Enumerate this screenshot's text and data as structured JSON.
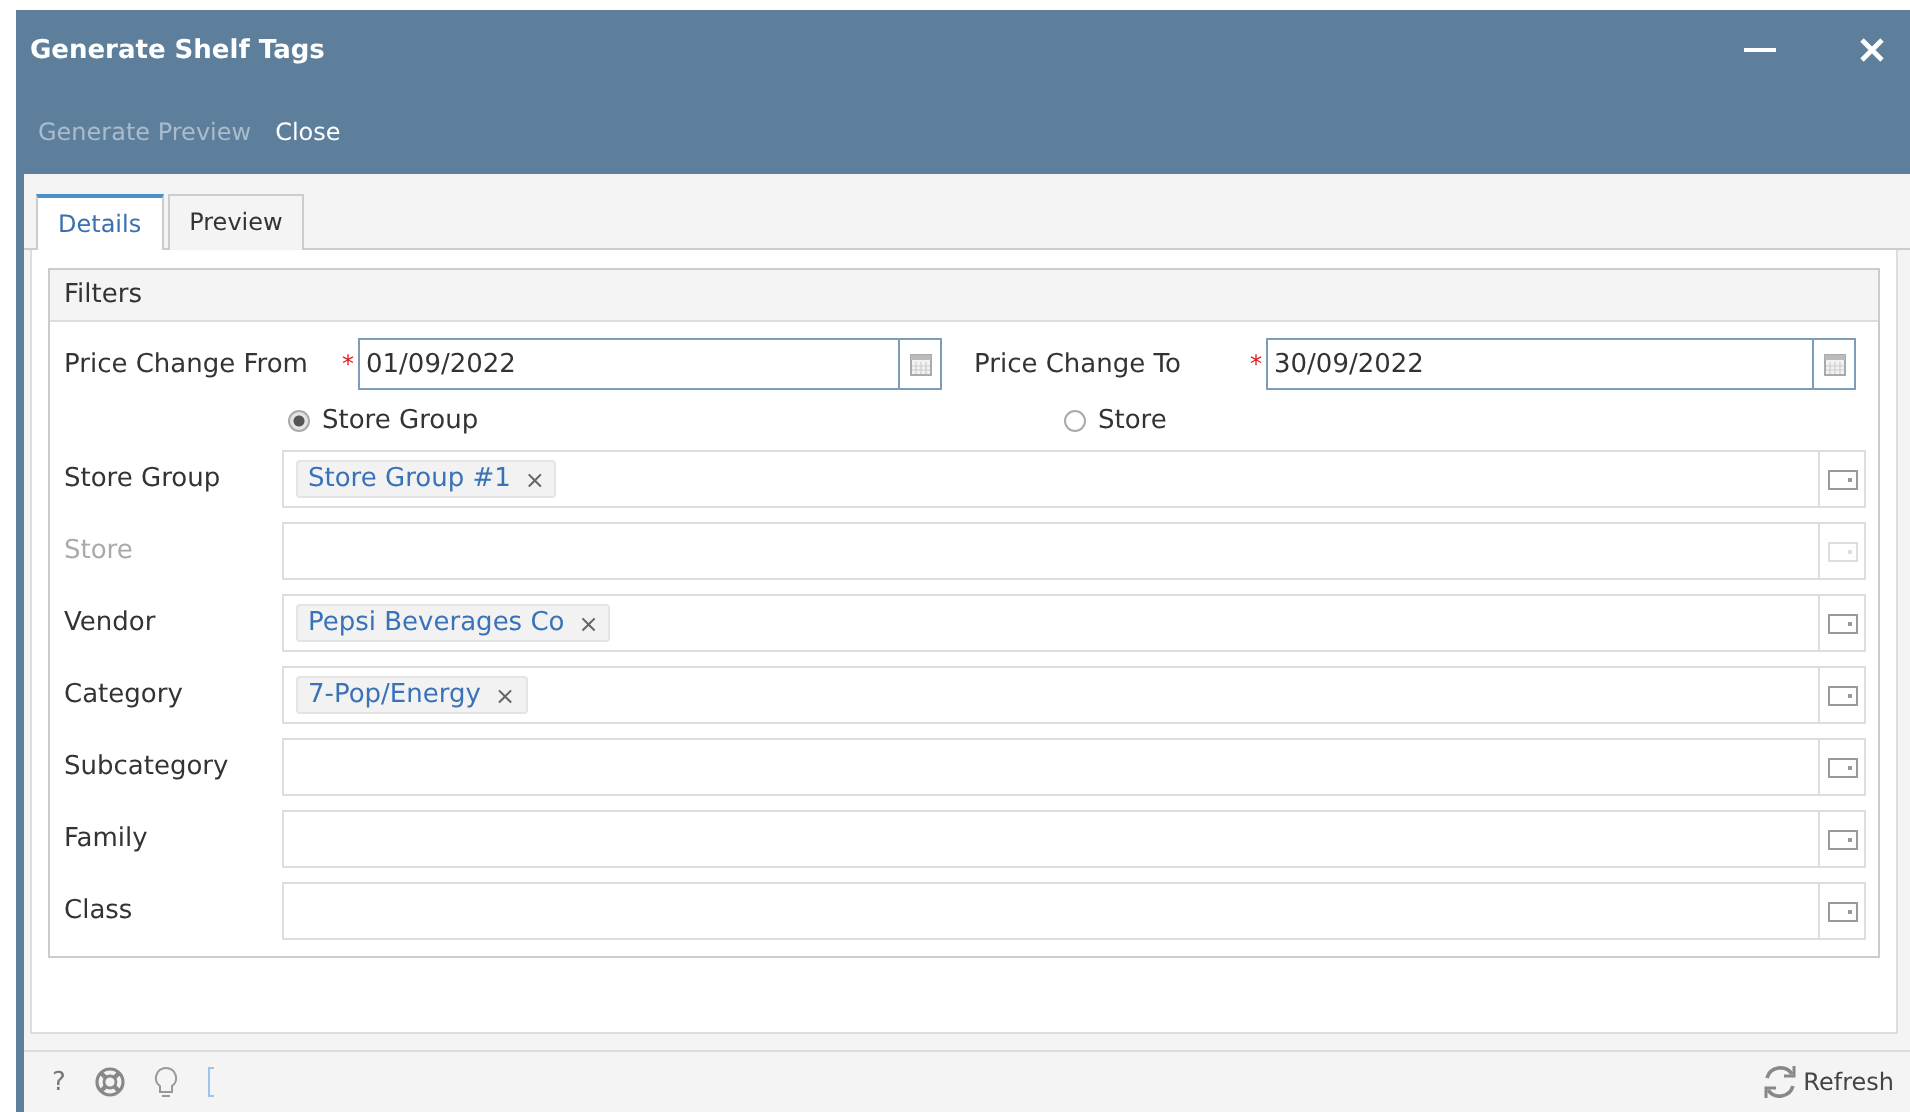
{
  "window": {
    "title": "Generate Shelf Tags"
  },
  "toolbar": [
    {
      "label": "Generate Preview",
      "disabled": true
    },
    {
      "label": "Close",
      "disabled": false
    }
  ],
  "tabs": [
    {
      "label": "Details",
      "selected": true
    },
    {
      "label": "Preview",
      "selected": false
    }
  ],
  "filters": {
    "title": "Filters",
    "date_fields": [
      {
        "label": "Price Change From",
        "required_mark": "*",
        "value": "01/09/2022"
      },
      {
        "label": "Price Change To",
        "required_mark": "*",
        "value": "30/09/2022"
      }
    ],
    "radios": [
      {
        "label": "Store Group",
        "selected": true
      },
      {
        "label": "Store",
        "selected": false
      }
    ],
    "fields": [
      {
        "label": "Store Group",
        "disabled": false,
        "tags": [
          {
            "text": "Store Group #1",
            "remove": "×"
          }
        ]
      },
      {
        "label": "Store",
        "disabled": true
      },
      {
        "label": "Vendor",
        "disabled": false,
        "tags": [
          {
            "text": "Pepsi Beverages Co",
            "remove": "×"
          }
        ]
      },
      {
        "label": "Category",
        "disabled": false,
        "tags": [
          {
            "text": "7-Pop/Energy",
            "remove": "×"
          }
        ]
      },
      {
        "label": "Subcategory",
        "disabled": false
      },
      {
        "label": "Family",
        "disabled": false
      },
      {
        "label": "Class",
        "disabled": false
      }
    ]
  },
  "status_bar": {
    "help": "?",
    "refresh": "Refresh"
  }
}
